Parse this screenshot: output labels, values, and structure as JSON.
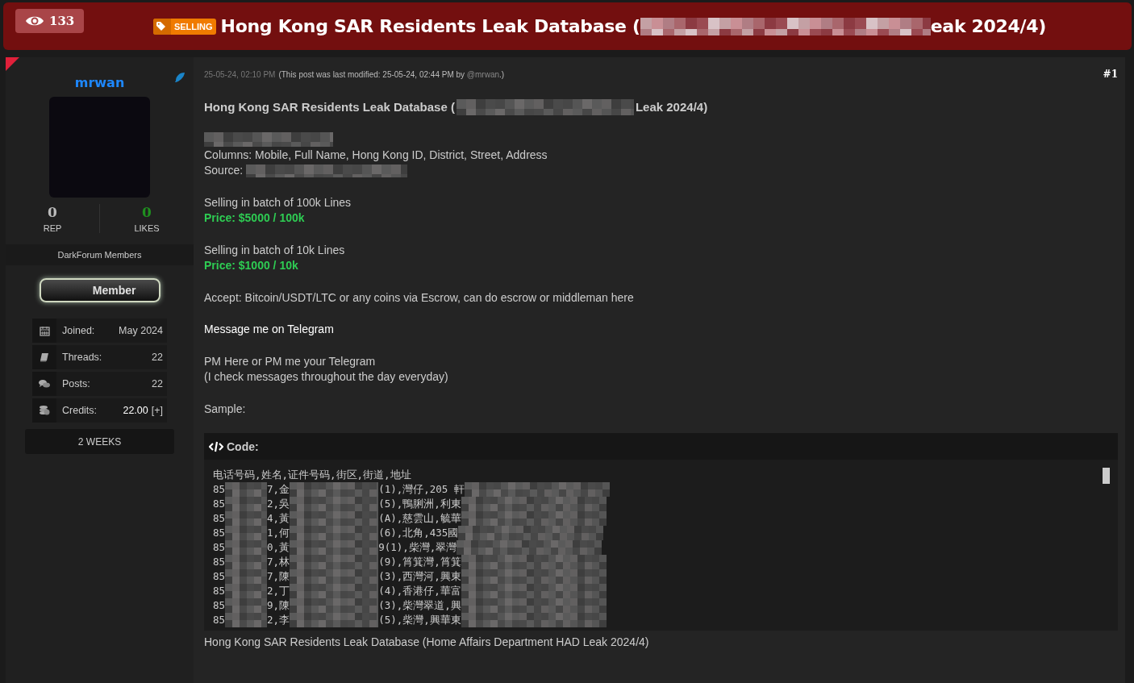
{
  "thread": {
    "views": "133",
    "prefix": "SELLING",
    "title_start": "Hong Kong SAR Residents Leak Database (",
    "title_end": "eak 2024/4)"
  },
  "author": {
    "username": "mrwan",
    "rep": {
      "value": "0",
      "label": "REP"
    },
    "likes": {
      "value": "0",
      "label": "LIKES"
    },
    "group": "DarkForum Members",
    "rank": "Member",
    "stats": [
      {
        "kind": "calendar",
        "label": "Joined:",
        "value": "May 2024"
      },
      {
        "kind": "book",
        "label": "Threads:",
        "value": "22"
      },
      {
        "kind": "comments",
        "label": "Posts:",
        "value": "22"
      },
      {
        "kind": "coins",
        "label": "Credits:",
        "value": "22.00",
        "action": "[+]"
      }
    ],
    "tenure": "2 WEEKS"
  },
  "post": {
    "date": "25-05-24, 02:10 PM",
    "edit_note": "(This post was last modified: 25-05-24, 02:44 PM by ",
    "edit_user": "@mrwan",
    "edit_close": ".)",
    "number": "#1",
    "paragraphs": [
      [
        {
          "kind": "heading",
          "text": "Hong Kong SAR Residents Leak Database (",
          "after": "Leak 2024/4)"
        }
      ],
      [
        {
          "kind": "redacted"
        },
        {
          "kind": "text",
          "text": "Columns: Mobile, Full Name, Hong Kong ID, District, Street, Address"
        },
        {
          "kind": "labelled",
          "text": "Source:"
        }
      ],
      [
        {
          "kind": "text",
          "text": "Selling in batch of 100k Lines"
        },
        {
          "kind": "price",
          "text": "Price: $5000 / 100k"
        }
      ],
      [
        {
          "kind": "text",
          "text": "Selling in batch of 10k Lines"
        },
        {
          "kind": "price",
          "text": "Price: $1000 / 10k"
        }
      ],
      [
        {
          "kind": "text",
          "text": "Accept: Bitcoin/USDT/LTC or any coins via Escrow, can do escrow or middleman here"
        }
      ],
      [
        {
          "kind": "link",
          "text": "Message me on Telegram"
        }
      ],
      [
        {
          "kind": "text",
          "text": "PM Here or PM me your Telegram"
        },
        {
          "kind": "text",
          "text": "(I check messages throughout the day everyday)"
        }
      ],
      [
        {
          "kind": "text",
          "text": "Sample:"
        }
      ]
    ],
    "code": {
      "label": "Code:",
      "header": "电话号码,姓名,证件号码,街区,街道,地址",
      "rows": [
        [
          "85",
          "7,金",
          "(1),灣仔,205 軒"
        ],
        [
          "85",
          "2,吳",
          "(5),鴨脷洲,利東"
        ],
        [
          "85",
          "4,黃",
          "(A),慈雲山,毓華"
        ],
        [
          "85",
          "1,何",
          "(6),北角,435國"
        ],
        [
          "85",
          "0,黃",
          "9(1),柴灣,翠灣"
        ],
        [
          "85",
          "7,林",
          "(9),筲箕灣,筲箕"
        ],
        [
          "85",
          "7,陳",
          "(3),西灣河,興東"
        ],
        [
          "85",
          "2,丁",
          "(4),香港仔,華富"
        ],
        [
          "85",
          "9,陳",
          "(3),柴灣翠道,興"
        ],
        [
          "85",
          "2,李",
          "(5),柴灣,興華東"
        ]
      ]
    },
    "caption": "Hong Kong SAR Residents Leak Database (Home Affairs Department HAD Leak 2024/4)"
  }
}
